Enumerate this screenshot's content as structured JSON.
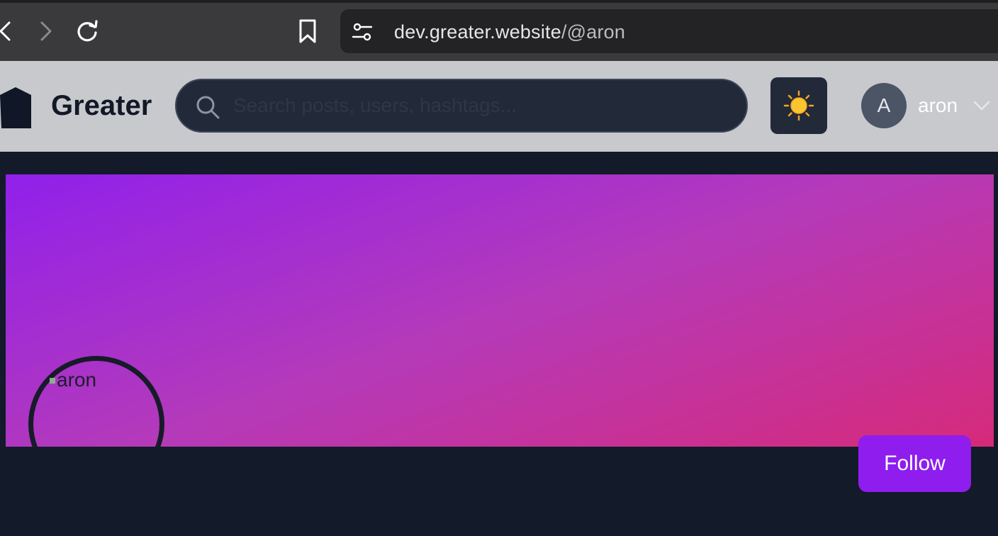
{
  "browser": {
    "url_host": "dev.greater.website",
    "url_path": "/@aron"
  },
  "header": {
    "brand": "Greater",
    "search_placeholder": "Search posts, users, hashtags...",
    "theme_icon": "☀️",
    "user_initial": "A",
    "username": "aron"
  },
  "profile": {
    "avatar_alt": "aron",
    "follow_label": "Follow"
  },
  "colors": {
    "follow_accent": "#8f1dee",
    "banner_start": "#9120eb",
    "banner_end": "#d62a7a",
    "page_background": "#131a29"
  }
}
